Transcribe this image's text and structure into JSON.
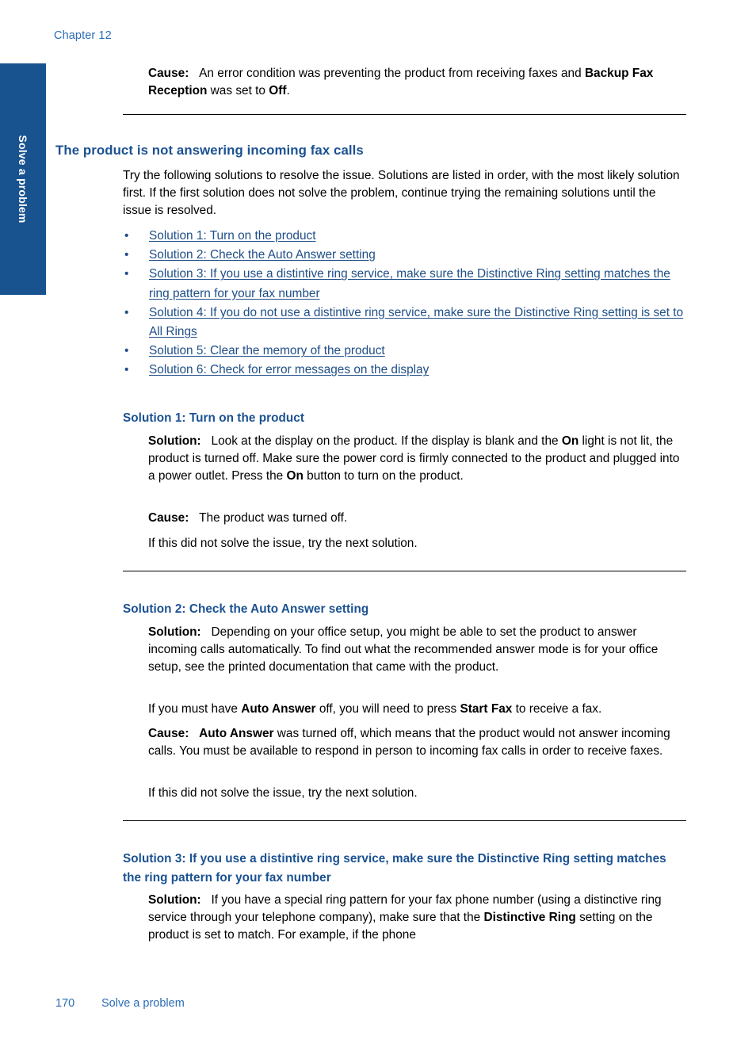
{
  "colors": {
    "tab_blue": "#18528f",
    "heading_blue": "#1b5192",
    "link_blue": "#1f4e87",
    "running_head_blue": "#2a6cb5",
    "rule_black": "#000000"
  },
  "running_head": "Chapter 12",
  "thumb_tab": {
    "label": "Solve a problem"
  },
  "top_cause": {
    "label": "Cause:",
    "text_1": "An error condition was preventing the product from receiving faxes and ",
    "bold_1": "Backup Fax Reception",
    "text_2": " was set to ",
    "bold_2": "Off",
    "text_3": "."
  },
  "section": {
    "title": "The product is not answering incoming fax calls",
    "intro": "Try the following solutions to resolve the issue. Solutions are listed in order, with the most likely solution first. If the first solution does not solve the problem, continue trying the remaining solutions until the issue is resolved.",
    "bullet_char": "•",
    "links": [
      "Solution 1: Turn on the product",
      "Solution 2: Check the Auto Answer setting",
      "Solution 3: If you use a distintive ring service, make sure the Distinctive Ring setting matches the ring pattern for your fax number",
      "Solution 4: If you do not use a distintive ring service, make sure the Distinctive Ring setting is set to All Rings",
      "Solution 5: Clear the memory of the product",
      "Solution 6: Check for error messages on the display"
    ]
  },
  "solution1": {
    "heading": "Solution 1: Turn on the product",
    "solution_label": "Solution:",
    "solution_text_1": "Look at the display on the product. If the display is blank and the ",
    "solution_bold_1": "On",
    "solution_text_2": " light is not lit, the product is turned off. Make sure the power cord is firmly connected to the product and plugged into a power outlet. Press the ",
    "solution_bold_2": "On",
    "solution_text_3": " button to turn on the product.",
    "cause_label": "Cause:",
    "cause_text": "The product was turned off.",
    "next": "If this did not solve the issue, try the next solution."
  },
  "solution2": {
    "heading": "Solution 2: Check the Auto Answer setting",
    "solution_label": "Solution:",
    "solution_text": "Depending on your office setup, you might be able to set the product to answer incoming calls automatically. To find out what the recommended answer mode is for your office setup, see the printed documentation that came with the product.",
    "note_text_1": "If you must have ",
    "note_bold_1": "Auto Answer",
    "note_text_2": " off, you will need to press ",
    "note_bold_2": "Start Fax",
    "note_text_3": " to receive a fax.",
    "cause_label": "Cause:",
    "cause_bold": "Auto Answer",
    "cause_text": " was turned off, which means that the product would not answer incoming calls. You must be available to respond in person to incoming fax calls in order to receive faxes.",
    "next": "If this did not solve the issue, try the next solution."
  },
  "solution3": {
    "heading": "Solution 3: If you use a distintive ring service, make sure the Distinctive Ring setting matches the ring pattern for your fax number",
    "solution_label": "Solution:",
    "solution_text_1": "If you have a special ring pattern for your fax phone number (using a distinctive ring service through your telephone company), make sure that the ",
    "solution_bold_1": "Distinctive Ring",
    "solution_text_2": " setting on the product is set to match. For example, if the phone"
  },
  "footer": {
    "page_number": "170",
    "title": "Solve a problem"
  }
}
